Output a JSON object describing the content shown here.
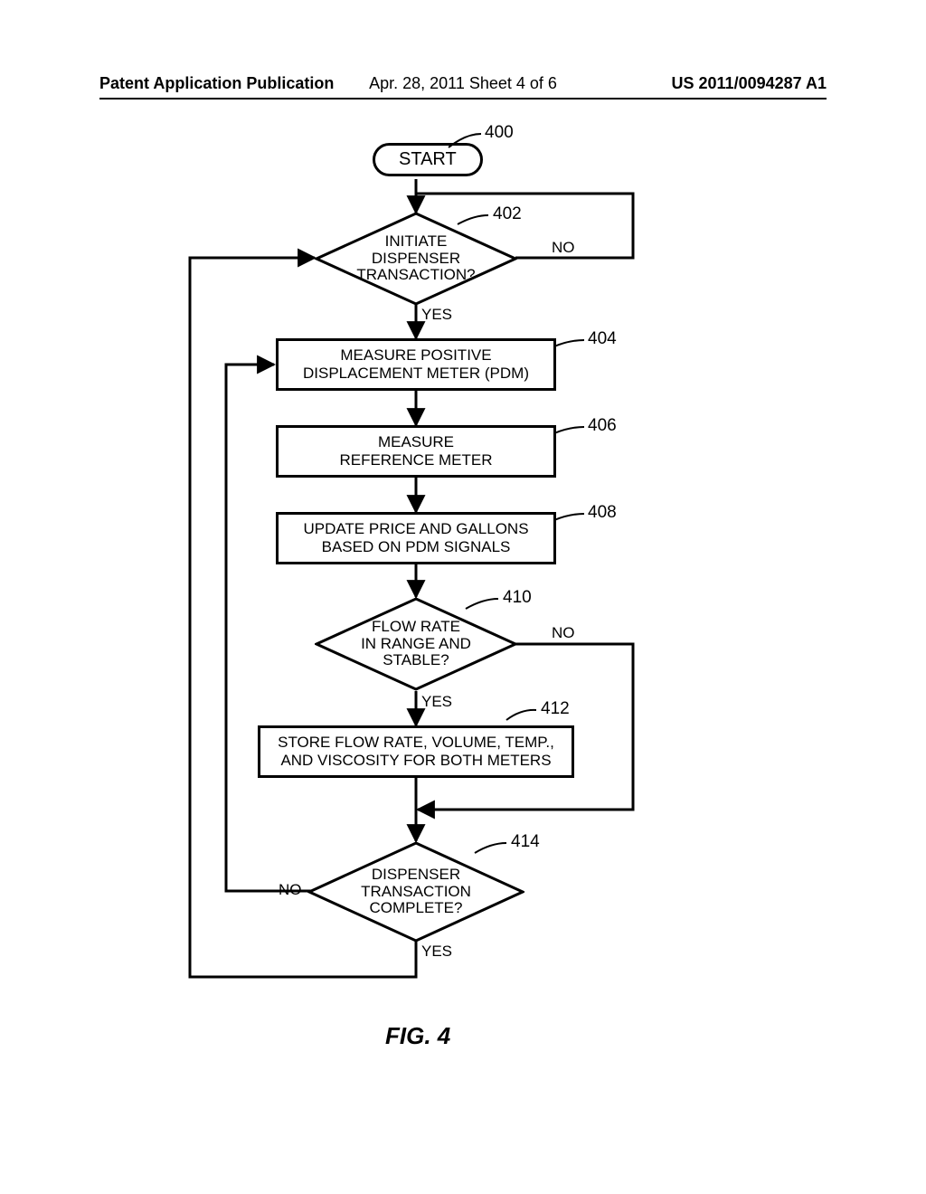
{
  "header": {
    "left": "Patent Application Publication",
    "center": "Apr. 28, 2011  Sheet 4 of 6",
    "right": "US 2011/0094287 A1"
  },
  "nodes": {
    "start": {
      "label": "START",
      "ref": "400"
    },
    "d1": {
      "label": "INITIATE\nDISPENSER\nTRANSACTION?",
      "ref": "402",
      "yes": "YES",
      "no": "NO"
    },
    "p1": {
      "label": "MEASURE POSITIVE\nDISPLACEMENT METER (PDM)",
      "ref": "404"
    },
    "p2": {
      "label": "MEASURE\nREFERENCE METER",
      "ref": "406"
    },
    "p3": {
      "label": "UPDATE PRICE AND GALLONS\nBASED ON PDM SIGNALS",
      "ref": "408"
    },
    "d2": {
      "label": "FLOW RATE\nIN RANGE AND\nSTABLE?",
      "ref": "410",
      "yes": "YES",
      "no": "NO"
    },
    "p4": {
      "label": "STORE FLOW RATE, VOLUME, TEMP.,\nAND VISCOSITY FOR BOTH METERS",
      "ref": "412"
    },
    "d3": {
      "label": "DISPENSER\nTRANSACTION\nCOMPLETE?",
      "ref": "414",
      "yes": "YES",
      "no": "NO"
    }
  },
  "figure_caption": "FIG. 4"
}
